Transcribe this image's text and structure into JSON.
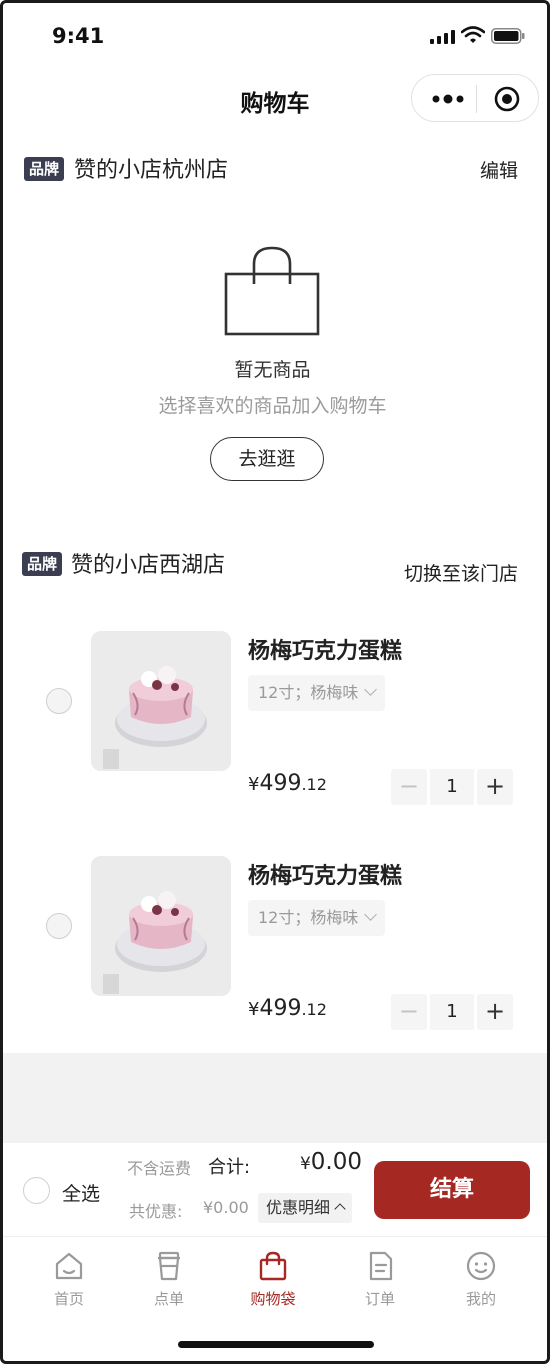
{
  "status_bar": {
    "time": "9:41"
  },
  "nav": {
    "title": "购物车"
  },
  "stores": [
    {
      "tag": "品牌",
      "name": "赞的小店杭州店",
      "action": "编辑"
    },
    {
      "tag": "品牌",
      "name": "赞的小店西湖店",
      "action": "切换至该门店"
    }
  ],
  "empty_state": {
    "title": "暂无商品",
    "subtitle": "选择喜欢的商品加入购物车",
    "button": "去逛逛"
  },
  "cart_items": [
    {
      "name": "杨梅巧克力蛋糕",
      "sku": "12寸；杨梅味",
      "price_symbol": "¥",
      "price_int": "499",
      "price_dec": ".12",
      "quantity": "1",
      "selected": false
    },
    {
      "name": "杨梅巧克力蛋糕",
      "sku": "12寸；杨梅味",
      "price_symbol": "¥",
      "price_int": "499",
      "price_dec": ".12",
      "quantity": "1",
      "selected": false
    }
  ],
  "stepper": {
    "minus": "−",
    "plus": "+"
  },
  "checkout": {
    "select_all": "全选",
    "shipping_note": "不含运费",
    "total_label": "合计:",
    "total_symbol": "¥",
    "total_value": "0.00",
    "discount_label": "共优惠:",
    "discount_value": "¥0.00",
    "discount_detail": "优惠明细",
    "button": "结算"
  },
  "tabs": [
    {
      "label": "首页",
      "icon": "home-icon",
      "active": false
    },
    {
      "label": "点单",
      "icon": "cup-icon",
      "active": false
    },
    {
      "label": "购物袋",
      "icon": "bag-icon",
      "active": true
    },
    {
      "label": "订单",
      "icon": "order-icon",
      "active": false
    },
    {
      "label": "我的",
      "icon": "face-icon",
      "active": false
    }
  ],
  "colors": {
    "accent": "#a52822",
    "brand_tag": "#3a3e50",
    "muted_text": "#9a9a9a"
  }
}
